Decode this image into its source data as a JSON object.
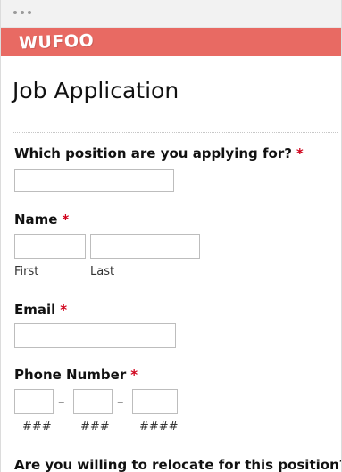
{
  "brand": {
    "logo_text": "WUFOO"
  },
  "form": {
    "title": "Job Application",
    "position": {
      "label": "Which position are you applying for?",
      "required_mark": "*",
      "value": ""
    },
    "name": {
      "label": "Name",
      "required_mark": "*",
      "first": {
        "sublabel": "First",
        "value": ""
      },
      "last": {
        "sublabel": "Last",
        "value": ""
      }
    },
    "email": {
      "label": "Email",
      "required_mark": "*",
      "value": ""
    },
    "phone": {
      "label": "Phone Number",
      "required_mark": "*",
      "separator": "–",
      "area": {
        "sublabel": "###",
        "value": ""
      },
      "prefix": {
        "sublabel": "###",
        "value": ""
      },
      "line": {
        "sublabel": "####",
        "value": ""
      }
    },
    "relocate": {
      "label": "Are you willing to relocate for this position?"
    }
  }
}
